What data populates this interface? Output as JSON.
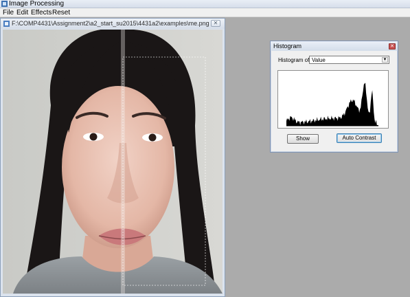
{
  "app": {
    "title": "Image Processing",
    "menu": [
      "File",
      "Edit",
      "Effects",
      "Reset"
    ]
  },
  "image_window": {
    "title": "F:\\COMP4431\\Assignment2\\a2_start_su2015\\4431a2\\examples\\me.png",
    "close_glyph": "✕",
    "image": "portrait-photo"
  },
  "histogram_window": {
    "title": "Histogram",
    "close_glyph": "✕",
    "histogram_of_label": "Histogram of:",
    "channel_selected": "Value",
    "show_button": "Show",
    "auto_contrast_button": "Auto Contrast"
  },
  "colors": {
    "mdi_background": "#ababab",
    "histogram_bars": "#000000",
    "close_red": "#c75050"
  }
}
